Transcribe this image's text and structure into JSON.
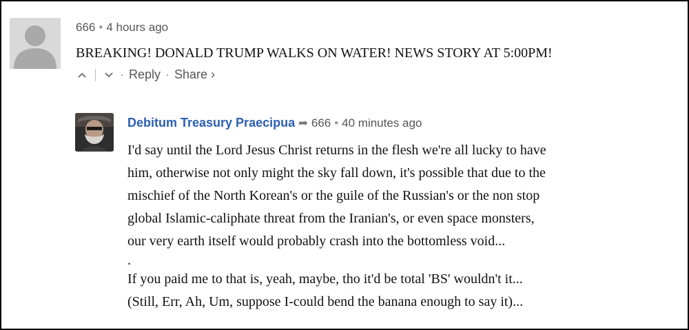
{
  "comment1": {
    "username": "666",
    "separator": "•",
    "timestamp": "4 hours ago",
    "text": "BREAKING! DONALD TRUMP WALKS ON WATER! NEWS STORY AT 5:00PM!",
    "actions": {
      "upvote_icon": "chevron-up-icon",
      "downvote_icon": "chevron-down-icon",
      "reply_label": "Reply",
      "share_label": "Share ›"
    }
  },
  "comment2": {
    "username": "Debitum Treasury Praecipua",
    "reply_arrow": "➦",
    "reply_to": "666",
    "separator": "•",
    "timestamp": "40 minutes ago",
    "lines": [
      "I'd say until the Lord Jesus Christ returns in the flesh we're all lucky to have",
      "him, otherwise not only might the sky fall down, it's possible that due to the",
      "mischief of the North Korean's or the guile of the Russian's or the non stop",
      "global Islamic-caliphate threat from the Iranian's, or even space monsters,",
      "our very earth itself would probably crash into the bottomless void...",
      ".",
      "If you paid me to that is, yeah, maybe, tho it'd be total 'BS' wouldn't it...",
      "(Still, Err, Ah, Um, suppose I-could bend the banana enough to say it)..."
    ]
  },
  "colors": {
    "username_link": "#2b5fb4",
    "meta_text": "#555555",
    "border": "#000000"
  }
}
